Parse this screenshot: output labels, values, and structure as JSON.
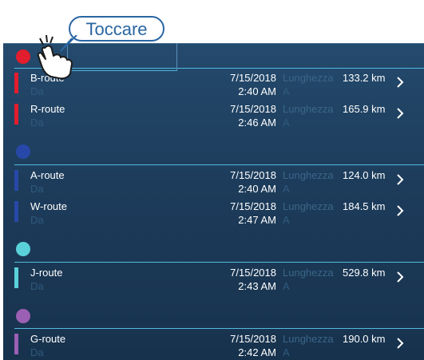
{
  "callout": {
    "text": "Toccare"
  },
  "labels": {
    "from": "Da",
    "to": "A",
    "length": "Lunghezza"
  },
  "groups": [
    {
      "color": "#e11d2e",
      "routes": [
        {
          "name": "B-route",
          "date": "7/15/2018",
          "time": "2:40 AM",
          "length": "133.2 km"
        },
        {
          "name": "R-route",
          "date": "7/15/2018",
          "time": "2:46 AM",
          "length": "165.9 km"
        }
      ]
    },
    {
      "color": "#2748a8",
      "routes": [
        {
          "name": "A-route",
          "date": "7/15/2018",
          "time": "2:40 AM",
          "length": "124.0 km"
        },
        {
          "name": "W-route",
          "date": "7/15/2018",
          "time": "2:47 AM",
          "length": "184.5 km"
        }
      ]
    },
    {
      "color": "#5ad1d9",
      "routes": [
        {
          "name": "J-route",
          "date": "7/15/2018",
          "time": "2:43 AM",
          "length": "529.8 km"
        }
      ]
    },
    {
      "color": "#9b5fb3",
      "routes": [
        {
          "name": "G-route",
          "date": "7/15/2018",
          "time": "2:42 AM",
          "length": "190.0 km"
        }
      ]
    }
  ]
}
